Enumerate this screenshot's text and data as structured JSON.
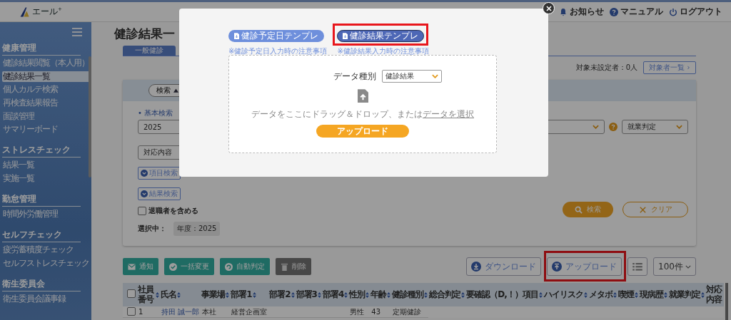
{
  "header": {
    "logo": "エール",
    "logo_mark": "+",
    "links": [
      {
        "label": "お知らせ",
        "kind": "bell"
      },
      {
        "label": "マニュアル",
        "kind": "help"
      },
      {
        "label": "ログアウト",
        "kind": "power"
      }
    ]
  },
  "sidebar": {
    "groups": [
      {
        "title": "健康管理",
        "items": [
          {
            "label": "健診結果閲覧（本人用）",
            "selected": false
          },
          {
            "label": "健診結果一覧",
            "selected": true
          },
          {
            "label": "個人カルテ検索",
            "selected": false
          },
          {
            "label": "再検査結果報告",
            "selected": false
          },
          {
            "label": "面談管理",
            "selected": false
          },
          {
            "label": "サマリーボード",
            "selected": false
          }
        ]
      },
      {
        "title": "ストレスチェック",
        "items": [
          {
            "label": "結果一覧",
            "selected": false
          },
          {
            "label": "実施一覧",
            "selected": false
          }
        ]
      },
      {
        "title": "勤怠管理",
        "items": [
          {
            "label": "時間外労働管理",
            "selected": false
          }
        ]
      },
      {
        "title": "セルフチェック",
        "items": [
          {
            "label": "疲労蓄積度チェック",
            "selected": false
          },
          {
            "label": "セルフストレスチェック",
            "selected": false
          }
        ]
      },
      {
        "title": "衛生委員会",
        "items": [
          {
            "label": "衛生委員会議事録",
            "selected": false
          }
        ]
      }
    ]
  },
  "page": {
    "title": "健診結果一",
    "tabs": [
      {
        "label": "一般健診",
        "selected": true
      }
    ],
    "unset_count": "対象未設定者：0人",
    "target_list_button": "対象者一覧 ›"
  },
  "search_panel": {
    "toggle": "検索",
    "section_label": "• 基本検索",
    "year_select": "2025",
    "judgement_select": "就業判定",
    "response_select": "対応内容",
    "item_search_button": "項目検索",
    "result_search_button": "結果検索",
    "include_retired": {
      "label": "退職者を含める",
      "checked": false
    },
    "selection_label": "選択中：",
    "selection_chips": [
      "年度：2025"
    ],
    "search_button": "検索",
    "clear_button": "クリア"
  },
  "actions": {
    "left": [
      {
        "label": "通知",
        "kind": "mail"
      },
      {
        "label": "一括変更",
        "kind": "check"
      },
      {
        "label": "自動判定",
        "kind": "auto"
      },
      {
        "label": "削除",
        "kind": "delete"
      }
    ],
    "download": "ダウンロード",
    "upload": "アップロード",
    "page_size": "100件"
  },
  "table": {
    "all_checked": false,
    "columns": [
      {
        "label": "社員番号",
        "sortable": true
      },
      {
        "label": "氏名",
        "sortable": true
      },
      {
        "label": "事業場",
        "sortable": true
      },
      {
        "label": "部署1",
        "sortable": true
      },
      {
        "label": "部署2",
        "sortable": true
      },
      {
        "label": "部署3",
        "sortable": true
      },
      {
        "label": "部署4",
        "sortable": true
      },
      {
        "label": "性別",
        "sortable": true
      },
      {
        "label": "年齢",
        "sortable": true
      },
      {
        "label": "健診種別",
        "sortable": true
      },
      {
        "label": "総合判定",
        "sortable": true
      },
      {
        "label": "要確認（D,！）項目",
        "sortable": true
      },
      {
        "label": "ハイリスク",
        "sortable": true
      },
      {
        "label": "メタボ",
        "sortable": true
      },
      {
        "label": "喫煙",
        "sortable": true
      },
      {
        "label": "現病歴",
        "sortable": true
      },
      {
        "label": "就業判定",
        "sortable": true
      },
      {
        "label": "対応内容",
        "sortable": false
      }
    ],
    "rows": [
      {
        "checked": false,
        "cells": [
          "1",
          "持田 誠一郎",
          "本社",
          "経営企画室",
          null,
          null,
          null,
          "男性",
          "43",
          "定期健診"
        ]
      }
    ]
  },
  "modal": {
    "templates": [
      {
        "label": "健診予定日テンプレ",
        "note": "※健診予定日入力時の注意事項",
        "selected": false
      },
      {
        "label": "健診結果テンプレ",
        "note": "※健診結果入力時の注意事項",
        "selected": true
      }
    ],
    "data_type_label": "データ種別",
    "data_type_value": "健診結果",
    "drop_text": "データをここにドラッグ＆ドロップ、または",
    "select_link": "データを選択",
    "upload_button": "アップロード"
  },
  "highlights": {
    "selected_template": true,
    "upload_button": true
  }
}
